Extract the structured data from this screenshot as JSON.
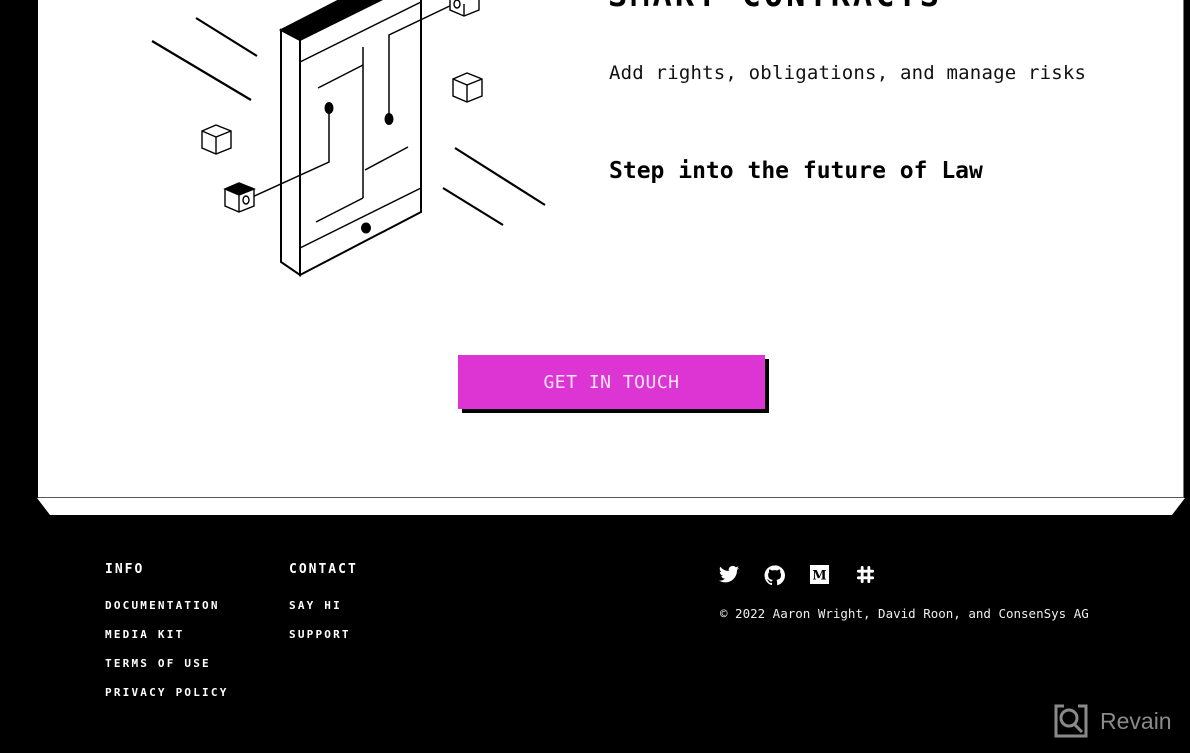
{
  "hero": {
    "heading": "SMART CONTRACTS",
    "subtitle": "Add rights, obligations, and manage risks",
    "tagline": "Step into the future of Law",
    "illustration": "isometric-tablet-with-circuit-and-cubes"
  },
  "cta": {
    "label": "GET IN TOUCH",
    "color": "#dd35d3"
  },
  "footer": {
    "info": {
      "title": "INFO",
      "links": [
        "DOCUMENTATION",
        "MEDIA KIT",
        "TERMS OF USE",
        "PRIVACY POLICY"
      ]
    },
    "contact": {
      "title": "CONTACT",
      "links": [
        "SAY HI",
        "SUPPORT"
      ]
    },
    "socials": [
      {
        "name": "twitter-icon"
      },
      {
        "name": "github-icon"
      },
      {
        "name": "medium-icon"
      },
      {
        "name": "slack-icon"
      }
    ],
    "copyright": "© 2022 Aaron Wright, David Roon, and ConsenSys AG"
  },
  "watermark": {
    "label": "Revain"
  }
}
